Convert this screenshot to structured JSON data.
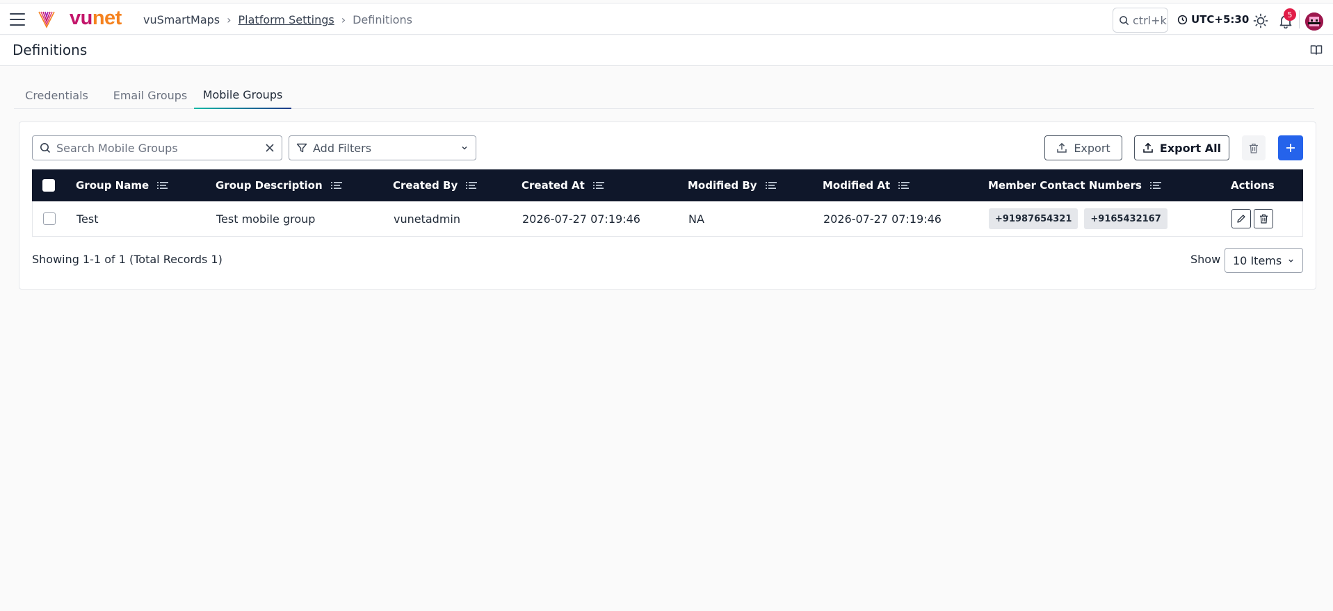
{
  "app": {
    "logo_text_vu": "vu",
    "logo_text_net": "net"
  },
  "breadcrumb": {
    "items": [
      "vuSmartMaps",
      "Platform Settings",
      "Definitions"
    ]
  },
  "topbar": {
    "search_shortcut": "ctrl+k",
    "timezone": "UTC+5:30",
    "notification_count": "5"
  },
  "page": {
    "title": "Definitions"
  },
  "tabs": [
    {
      "label": "Credentials",
      "active": false
    },
    {
      "label": "Email Groups",
      "active": false
    },
    {
      "label": "Mobile Groups",
      "active": true
    }
  ],
  "toolbar": {
    "search_placeholder": "Search Mobile Groups",
    "filters_label": "Add Filters",
    "export_label": "Export",
    "export_all_label": "Export All"
  },
  "table": {
    "columns": [
      "Group Name",
      "Group Description",
      "Created By",
      "Created At",
      "Modified By",
      "Modified At",
      "Member Contact Numbers",
      "Actions"
    ],
    "rows": [
      {
        "group_name": "Test",
        "group_description": "Test mobile group",
        "created_by": "vunetadmin",
        "created_at": "2026-07-27 07:19:46",
        "modified_by": "NA",
        "modified_at": "2026-07-27 07:19:46",
        "contacts": [
          "+91987654321",
          "+9165432167"
        ]
      }
    ]
  },
  "pagination": {
    "summary": "Showing 1-1 of 1 (Total Records 1)",
    "show_label": "Show",
    "page_size": "10 Items"
  },
  "colors": {
    "brand_magenta": "#c3166b",
    "brand_orange": "#f5821f",
    "header_navy": "#0f172a",
    "primary_blue": "#2563eb",
    "badge_red": "#e11d48"
  }
}
